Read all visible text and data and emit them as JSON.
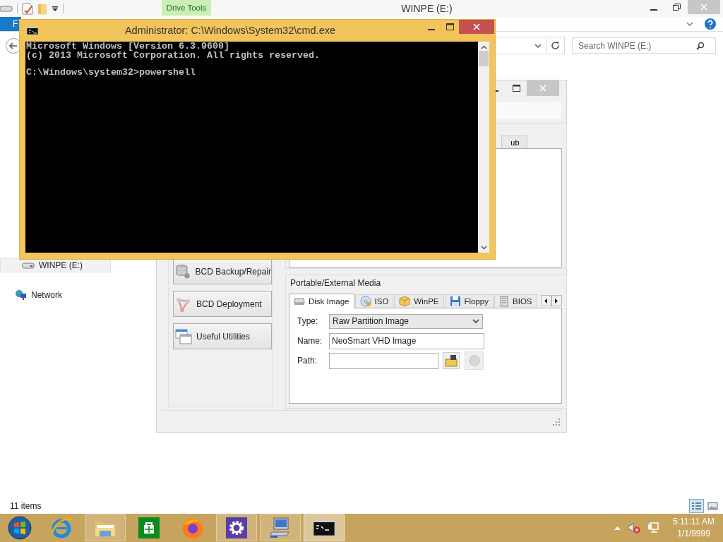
{
  "explorer": {
    "title": "WINPE (E:)",
    "contextual_tab": "Drive Tools",
    "file_tab": "F",
    "search": {
      "placeholder": "Search WINPE (E:)"
    },
    "nav_items": [
      {
        "label": "WINPE (E:)",
        "kind": "drive",
        "selected": true
      },
      {
        "label": "Network",
        "kind": "network",
        "selected": false
      }
    ],
    "status": "11 items",
    "views": [
      {
        "kind": "details",
        "selected": true
      },
      {
        "kind": "thumbnails",
        "selected": false
      }
    ]
  },
  "easybcd": {
    "side_buttons": [
      {
        "label": "BCD Backup/Repair",
        "kind": "database"
      },
      {
        "label": "BCD Deployment",
        "kind": "network"
      },
      {
        "label": "Useful Utilities",
        "kind": "windows"
      }
    ],
    "upper_tab": "ub",
    "media": {
      "title": "Portable/External Media",
      "tabs": [
        {
          "label": "Disk Image",
          "kind": "disk",
          "selected": true
        },
        {
          "label": "ISO",
          "kind": "disc",
          "selected": false
        },
        {
          "label": "WinPE",
          "kind": "box",
          "selected": false
        },
        {
          "label": "Floppy",
          "kind": "floppy",
          "selected": false
        },
        {
          "label": "BIOS",
          "kind": "chip",
          "selected": false
        }
      ],
      "fields": [
        {
          "label": "Type:",
          "kind": "dropdown",
          "value": "Raw Partition Image"
        },
        {
          "label": "Name:",
          "kind": "text",
          "value": "NeoSmart VHD Image"
        },
        {
          "label": "Path:",
          "kind": "path"
        }
      ]
    }
  },
  "cmd": {
    "title": "Administrator: C:\\Windows\\System32\\cmd.exe",
    "blocks": [
      [
        "Microsoft Windows [Version 6.3.9600]",
        "(c) 2013 Microsoft Corporation. All rights reserved."
      ],
      [
        "C:\\Windows\\system32>powershell"
      ]
    ]
  },
  "taskbar": {
    "buttons": [
      {
        "kind": "start",
        "running": false,
        "active": false
      },
      {
        "kind": "ie",
        "running": false,
        "active": false
      },
      {
        "kind": "explorer",
        "running": true,
        "active": false
      },
      {
        "kind": "store",
        "running": false,
        "active": false
      },
      {
        "kind": "firefox",
        "running": false,
        "active": false
      },
      {
        "kind": "settings",
        "running": true,
        "active": false
      },
      {
        "kind": "computer",
        "running": true,
        "active": false
      },
      {
        "kind": "cmd",
        "running": true,
        "active": true
      }
    ],
    "clock": {
      "time": "5:11:11 AM",
      "date": "1/1/9999"
    }
  }
}
